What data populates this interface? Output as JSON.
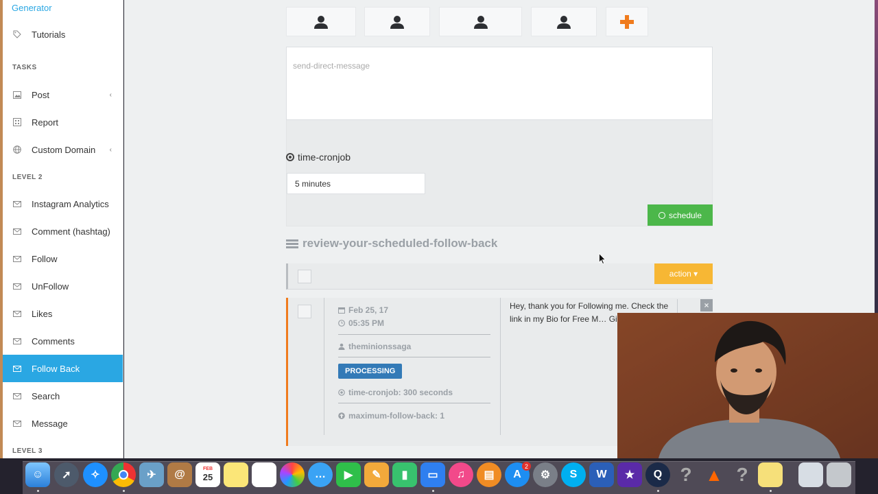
{
  "sidebar": {
    "generator_label": "Generator",
    "tutorials_label": "Tutorials",
    "tasks_heading": "TASKS",
    "level2_heading": "LEVEL 2",
    "level3_heading": "LEVEL 3",
    "items": [
      {
        "label": "Post",
        "icon": "image-icon"
      },
      {
        "label": "Report",
        "icon": "grid-icon"
      },
      {
        "label": "Custom Domain",
        "icon": "globe-icon"
      },
      {
        "label": "Instagram Analytics",
        "icon": "envelope-icon"
      },
      {
        "label": "Comment (hashtag)",
        "icon": "envelope-icon"
      },
      {
        "label": "Follow",
        "icon": "envelope-icon"
      },
      {
        "label": "UnFollow",
        "icon": "envelope-icon"
      },
      {
        "label": "Likes",
        "icon": "envelope-icon"
      },
      {
        "label": "Comments",
        "icon": "envelope-icon"
      },
      {
        "label": "Follow Back",
        "icon": "envelope-icon",
        "active": true
      },
      {
        "label": "Search",
        "icon": "envelope-icon"
      },
      {
        "label": "Message",
        "icon": "envelope-icon"
      }
    ]
  },
  "form": {
    "message_placeholder": "send-direct-message",
    "cron_label": "time-cronjob",
    "cron_value": "5 minutes",
    "schedule_label": "schedule"
  },
  "review": {
    "title": "review-your-scheduled-follow-back",
    "action_label": "action ▾",
    "item": {
      "date": "Feb 25, 17",
      "time": "05:35 PM",
      "username": "theminionssaga",
      "status": "PROCESSING",
      "cronjob": "time-cronjob: 300 seconds",
      "max_follow_back": "maximum-follow-back: 1",
      "message": "Hey, thank you for Following me. Check the link in my Bio for Free M… Giveaways :D",
      "close": "×"
    }
  },
  "dock": {
    "calendar_month": "FEB",
    "calendar_day": "25",
    "appstore_badge": "2"
  },
  "colors": {
    "accent": "#2aa7e3",
    "schedule_green": "#4cb74a",
    "action_yellow": "#f7b734",
    "processing_blue": "#337ab7",
    "card_orange": "#f07b1d"
  }
}
